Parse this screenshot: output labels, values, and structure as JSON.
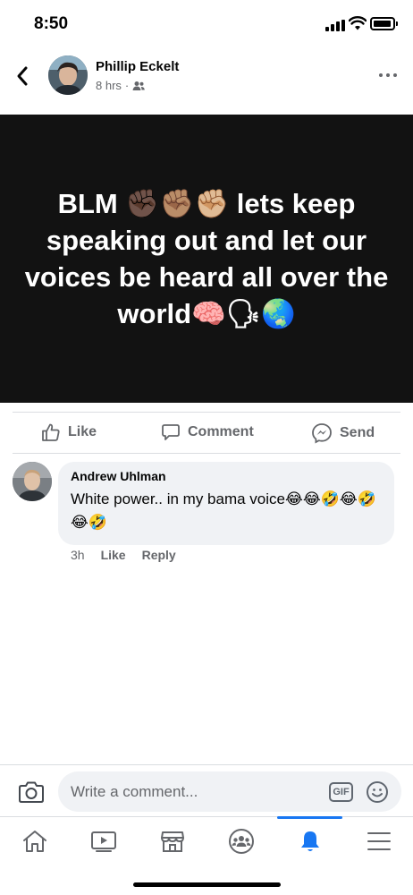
{
  "status_bar": {
    "time": "8:50"
  },
  "post": {
    "author": "Phillip Eckelt",
    "time": "8 hrs",
    "separator": "·",
    "privacy_icon": "friends-icon",
    "text": "BLM ✊🏿✊🏽✊🏼 lets keep speaking out and let our voices be heard all over the world🧠🗣🌏",
    "background_color": "#121212"
  },
  "actions": {
    "like_label": "Like",
    "comment_label": "Comment",
    "send_label": "Send"
  },
  "comment": {
    "author": "Andrew Uhlman",
    "text": "White power.. in my bama voice😂😂🤣😂🤣😂🤣",
    "time": "3h",
    "like_label": "Like",
    "reply_label": "Reply"
  },
  "composer": {
    "placeholder": "Write a comment...",
    "gif_label": "GIF"
  },
  "tab_bar": {
    "items": [
      "home-icon",
      "watch-icon",
      "marketplace-icon",
      "groups-icon",
      "notifications-icon",
      "menu-icon"
    ],
    "active": "notifications-icon",
    "accent_color": "#1877f2"
  }
}
